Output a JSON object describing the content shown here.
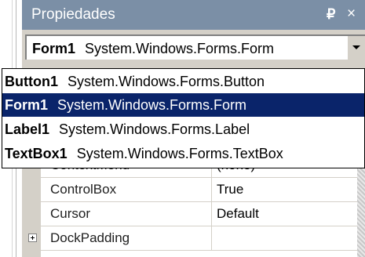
{
  "panel": {
    "title": "Propiedades",
    "pin_glyph": "ᵖ",
    "close_glyph": "×"
  },
  "object_selector": {
    "name": "Form1",
    "type": "System.Windows.Forms.Form"
  },
  "dropdown": {
    "items": [
      {
        "name": "Button1",
        "type": "System.Windows.Forms.Button",
        "selected": false
      },
      {
        "name": "Form1",
        "type": "System.Windows.Forms.Form",
        "selected": true
      },
      {
        "name": "Label1",
        "type": "System.Windows.Forms.Label",
        "selected": false
      },
      {
        "name": "TextBox1",
        "type": "System.Windows.Forms.TextBox",
        "selected": false
      }
    ]
  },
  "properties": [
    {
      "name": "ContextMenu",
      "value": "(none)"
    },
    {
      "name": "ControlBox",
      "value": "True"
    },
    {
      "name": "Cursor",
      "value": "Default"
    },
    {
      "name": "DockPadding",
      "value": "",
      "expandable": true
    }
  ],
  "colors": {
    "titlebar_bg": "#7b8fa6",
    "selection_bg": "#0a246a",
    "panel_bg": "#d4d0c8"
  }
}
